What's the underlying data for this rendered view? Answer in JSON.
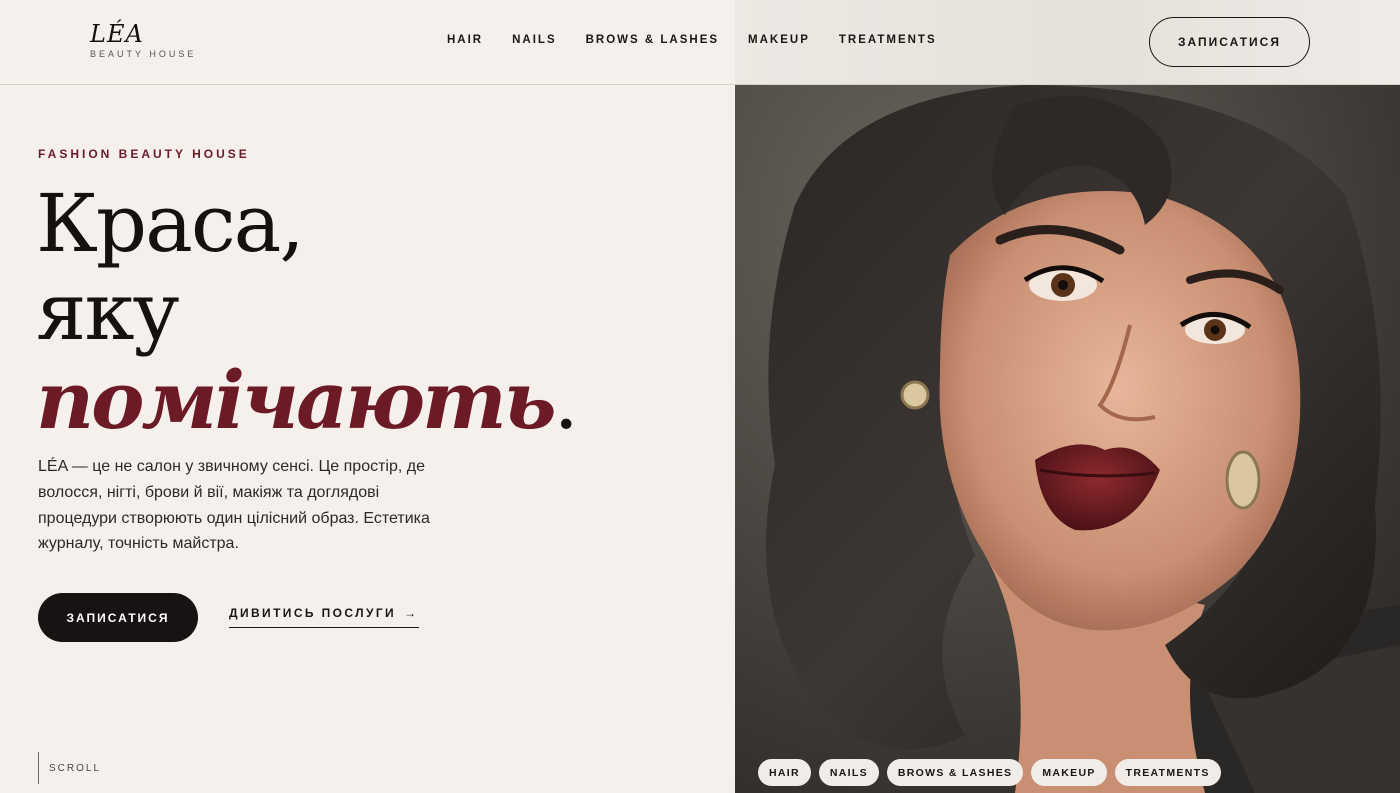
{
  "brand": {
    "name": "LÉA",
    "tagline": "BEAUTY HOUSE"
  },
  "nav": {
    "items": [
      {
        "label": "HAIR"
      },
      {
        "label": "NAILS"
      },
      {
        "label": "BROWS & LASHES"
      },
      {
        "label": "MAKEUP"
      },
      {
        "label": "TREATMENTS"
      }
    ],
    "cta_label": "ЗАПИСАТИСЯ"
  },
  "hero": {
    "eyebrow": "FASHION BEAUTY HOUSE",
    "headline_line1": "Краса,",
    "headline_line2": "яку",
    "headline_accent": "помічають",
    "headline_dot": ".",
    "intro": "LÉA — це не салон у звичному сенсі. Це простір, де волосся, нігті, брови й вії, макіяж та доглядові процедури створюють один цілісний образ. Естетика журналу, точність майстра.",
    "primary_button": "ЗАПИСАТИСЯ",
    "secondary_link": "ДИВИТИСЬ ПОСЛУГИ",
    "secondary_link_arrow": "→",
    "scroll_label": "SCROLL"
  },
  "image_tags": [
    {
      "label": "HAIR"
    },
    {
      "label": "NAILS"
    },
    {
      "label": "BROWS & LASHES"
    },
    {
      "label": "MAKEUP"
    },
    {
      "label": "TREATMENTS"
    }
  ],
  "colors": {
    "background": "#f5f0eb",
    "accent": "#6b1a26",
    "ink": "#1a1614",
    "button_dark": "#161312"
  },
  "icons": {
    "arrow": "arrow-right-icon"
  }
}
